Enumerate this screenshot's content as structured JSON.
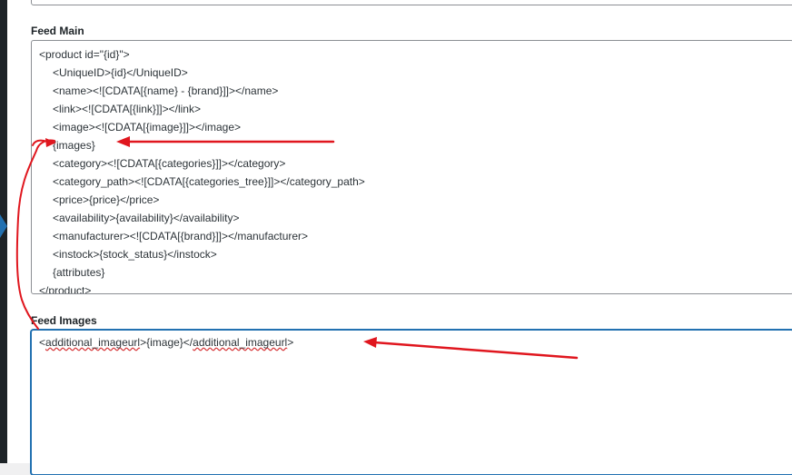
{
  "feed_main": {
    "label": "Feed Main",
    "lines": [
      {
        "text": "<product id=\"{id}\">",
        "indent": false
      },
      {
        "text": "<UniqueID>{id}</UniqueID>",
        "indent": true
      },
      {
        "text": "<name><![CDATA[{name} - {brand}]]></name>",
        "indent": true
      },
      {
        "text": "<link><![CDATA[{link}]]></link>",
        "indent": true
      },
      {
        "text": "<image><![CDATA[{image}]]></image>",
        "indent": true
      },
      {
        "text": "{images}",
        "indent": true
      },
      {
        "text": "<category><![CDATA[{categories}]]></category>",
        "indent": true
      },
      {
        "text": "<category_path><![CDATA[{categories_tree}]]></category_path>",
        "indent": true
      },
      {
        "text": "<price>{price}</price>",
        "indent": true
      },
      {
        "text": "<availability>{availability}</availability>",
        "indent": true
      },
      {
        "text": "<manufacturer><![CDATA[{brand}]]></manufacturer>",
        "indent": true
      },
      {
        "text": "<instock>{stock_status}</instock>",
        "indent": true
      },
      {
        "text": "{attributes}",
        "indent": true
      },
      {
        "text": "</product>",
        "indent": false
      }
    ]
  },
  "feed_images": {
    "label": "Feed Images",
    "segments": [
      {
        "text": "<",
        "spell": false
      },
      {
        "text": "additional_imageurl",
        "spell": true
      },
      {
        "text": ">{image}</",
        "spell": false
      },
      {
        "text": "additional_imageurl",
        "spell": true
      },
      {
        "text": ">",
        "spell": false
      }
    ]
  },
  "colors": {
    "annotation_red": "#e0161e",
    "focus_blue": "#2271b1"
  }
}
